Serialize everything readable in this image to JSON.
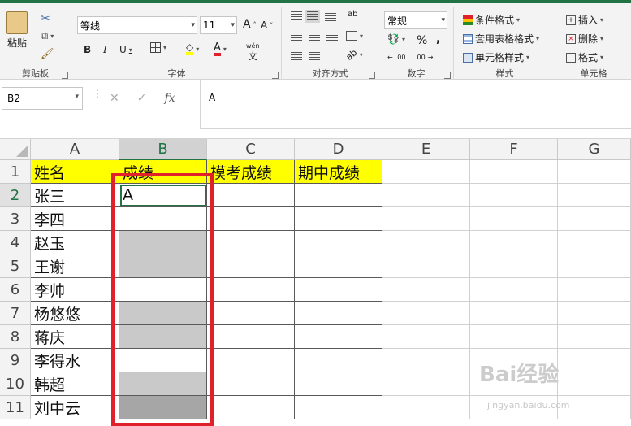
{
  "ribbon": {
    "clipboard": {
      "label": "剪贴板",
      "paste": "粘贴"
    },
    "font": {
      "label": "字体",
      "name": "等线",
      "size": "11",
      "bold": "B",
      "italic": "I",
      "underline": "U",
      "grow": "A",
      "shrink": "A",
      "phonetic": "wén"
    },
    "alignment": {
      "label": "对齐方式",
      "wrap": "ab"
    },
    "number": {
      "label": "数字",
      "format": "常规",
      "percent": "%",
      "comma": ",",
      "inc_decimal": ".00",
      "dec_decimal": ".00"
    },
    "styles": {
      "label": "样式",
      "conditional": "条件格式",
      "table": "套用表格格式",
      "cell": "单元格样式"
    },
    "cells": {
      "label": "单元格",
      "insert": "插入",
      "delete": "删除",
      "format": "格式"
    }
  },
  "formula_bar": {
    "name_box": "B2",
    "cancel": "✕",
    "enter": "✓",
    "fx": "fx",
    "content": "A"
  },
  "columns": [
    "A",
    "B",
    "C",
    "D",
    "E",
    "F",
    "G"
  ],
  "rows": [
    "1",
    "2",
    "3",
    "4",
    "5",
    "6",
    "7",
    "8",
    "9",
    "10",
    "11"
  ],
  "headers": {
    "a1": "姓名",
    "b1": "成绩",
    "c1": "模考成绩",
    "d1": "期中成绩"
  },
  "names": [
    "张三",
    "李四",
    "赵玉",
    "王谢",
    "李帅",
    "杨悠悠",
    "蒋庆",
    "李得水",
    "韩超",
    "刘中云"
  ],
  "b_values": [
    "A",
    "",
    "",
    "",
    "",
    "",
    "",
    "",
    "",
    ""
  ],
  "watermark": {
    "logo": "Bai经验",
    "url": "jingyan.baidu.com"
  }
}
